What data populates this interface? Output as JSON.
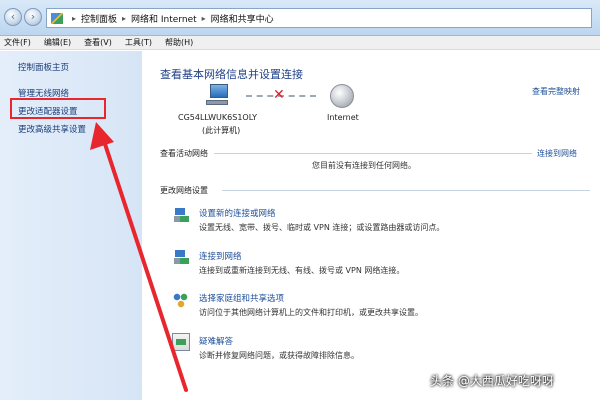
{
  "breadcrumb": {
    "items": [
      "控制面板",
      "网络和 Internet",
      "网络和共享中心"
    ]
  },
  "menu": {
    "items": [
      "文件(F)",
      "编辑(E)",
      "查看(V)",
      "工具(T)",
      "帮助(H)"
    ]
  },
  "sidebar": {
    "items": [
      {
        "label": "控制面板主页"
      },
      {
        "label": "管理无线网络"
      },
      {
        "label": "更改适配器设置"
      },
      {
        "label": "更改高级共享设置"
      }
    ]
  },
  "main": {
    "title": "查看基本网络信息并设置连接",
    "view_map": "查看完整映射",
    "computer_name": "CG54LLWUK6S1OLY",
    "computer_sub": "(此计算机)",
    "internet_label": "Internet",
    "active_networks_label": "查看活动网络",
    "connect_link": "连接到网络",
    "not_connected": "您目前没有连接到任何网络。",
    "change_settings_label": "更改网络设置",
    "tasks": [
      {
        "title": "设置新的连接或网络",
        "desc": "设置无线、宽带、拨号、临时或 VPN 连接；或设置路由器或访问点。"
      },
      {
        "title": "连接到网络",
        "desc": "连接到或重新连接到无线、有线、拨号或 VPN 网络连接。"
      },
      {
        "title": "选择家庭组和共享选项",
        "desc": "访问位于其他网络计算机上的文件和打印机，或更改共享设置。"
      },
      {
        "title": "疑难解答",
        "desc": "诊断并修复网络问题，或获得故障排除信息。"
      }
    ]
  },
  "watermark": "头条 @大西瓜好吃呀呀",
  "colors": {
    "annotation_red": "#e8262e",
    "link_blue": "#1f4f9a"
  }
}
